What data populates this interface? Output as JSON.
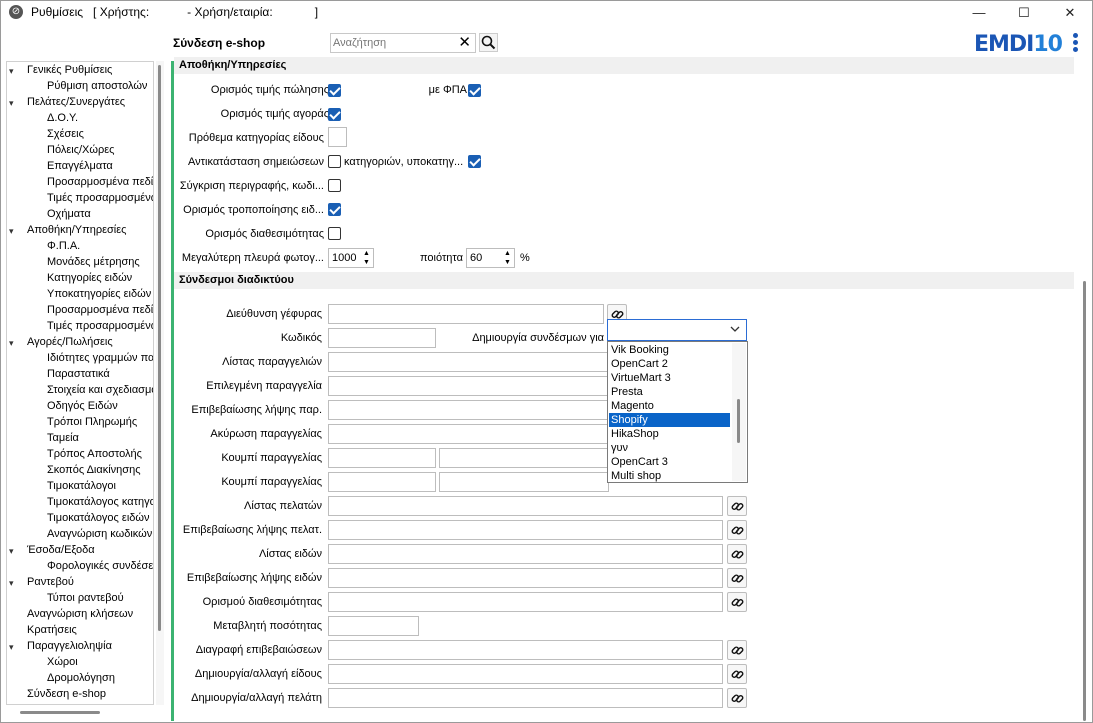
{
  "window": {
    "title_prefix": "Ρυθμίσεις",
    "user_label": "[ Χρήστης:",
    "company_label": "- Χρήση/εταιρία:",
    "close_bracket": "]",
    "minimize": "—",
    "maximize": "☐",
    "close": "✕"
  },
  "toolbar": {
    "screen_name": "Σύνδεση e-shop",
    "search_placeholder": "Αναζήτηση",
    "clear_glyph": "✕",
    "logo_a": "EMDI",
    "logo_b": "10"
  },
  "tree": [
    {
      "label": "Γενικές Ρυθμίσεις",
      "level": 0,
      "expanded": true
    },
    {
      "label": "Ρύθμιση αποστολών",
      "level": 2
    },
    {
      "label": "Πελάτες/Συνεργάτες",
      "level": 0,
      "expanded": true
    },
    {
      "label": "Δ.Ο.Υ.",
      "level": 2
    },
    {
      "label": "Σχέσεις",
      "level": 2
    },
    {
      "label": "Πόλεις/Χώρες",
      "level": 2
    },
    {
      "label": "Επαγγέλματα",
      "level": 2
    },
    {
      "label": "Προσαρμοσμένα πεδί",
      "level": 2
    },
    {
      "label": "Τιμές προσαρμοσμένω",
      "level": 2
    },
    {
      "label": "Οχήματα",
      "level": 2
    },
    {
      "label": "Αποθήκη/Υπηρεσίες",
      "level": 0,
      "expanded": true
    },
    {
      "label": "Φ.Π.Α.",
      "level": 2
    },
    {
      "label": "Μονάδες μέτρησης",
      "level": 2
    },
    {
      "label": "Κατηγορίες ειδών",
      "level": 2
    },
    {
      "label": "Υποκατηγορίες ειδών",
      "level": 2
    },
    {
      "label": "Προσαρμοσμένα πεδί",
      "level": 2
    },
    {
      "label": "Τιμές προσαρμοσμένω",
      "level": 2
    },
    {
      "label": "Αγορές/Πωλήσεις",
      "level": 0,
      "expanded": true
    },
    {
      "label": "Ιδιότητες γραμμών πα",
      "level": 2
    },
    {
      "label": "Παραστατικά",
      "level": 2
    },
    {
      "label": "Στοιχεία και σχεδιασμό",
      "level": 2
    },
    {
      "label": "Οδηγός Ειδών",
      "level": 2
    },
    {
      "label": "Τρόποι Πληρωμής",
      "level": 2
    },
    {
      "label": "Ταμεία",
      "level": 2
    },
    {
      "label": "Τρόπος Αποστολής",
      "level": 2
    },
    {
      "label": "Σκοπός Διακίνησης",
      "level": 2
    },
    {
      "label": "Τιμοκατάλογοι",
      "level": 2
    },
    {
      "label": "Τιμοκατάλογος κατηγο",
      "level": 2
    },
    {
      "label": "Τιμοκατάλογος ειδών",
      "level": 2
    },
    {
      "label": "Αναγνώριση κωδικών",
      "level": 2
    },
    {
      "label": "Έσοδα/Εξοδα",
      "level": 0,
      "expanded": true
    },
    {
      "label": "Φορολογικές συνδέσε",
      "level": 2
    },
    {
      "label": "Ραντεβού",
      "level": 0,
      "expanded": true
    },
    {
      "label": "Τύποι ραντεβού",
      "level": 2
    },
    {
      "label": "Αναγνώριση κλήσεων",
      "level": 1
    },
    {
      "label": "Κρατήσεις",
      "level": 1
    },
    {
      "label": "Παραγγελιοληψία",
      "level": 0,
      "expanded": true
    },
    {
      "label": "Χώροι",
      "level": 2
    },
    {
      "label": "Δρομολόγηση",
      "level": 2
    },
    {
      "label": "Σύνδεση e-shop",
      "level": 1
    }
  ],
  "sections": {
    "warehouse": "Αποθήκη/Υπηρεσίες",
    "links": "Σύνδεσμοι διαδικτύου"
  },
  "warehouse": {
    "sale_price": {
      "label": "Ορισμός τιμής πώλησης",
      "checked": true
    },
    "with_vat": {
      "label": "με ΦΠΑ",
      "checked": true
    },
    "purchase_price": {
      "label": "Ορισμός τιμής αγοράς",
      "checked": true
    },
    "category_prefix": {
      "label": "Πρόθεμα κατηγορίας είδους",
      "value": ""
    },
    "replace_notes": {
      "label": "Αντικατάσταση σημειώσεων",
      "checked": false
    },
    "categories_sub": {
      "label": "κατηγοριών, υποκατηγ...",
      "checked": true
    },
    "compare_desc": {
      "label": "Σύγκριση περιγραφής, κωδι...",
      "checked": false
    },
    "modify_item": {
      "label": "Ορισμός τροποποίησης ειδ...",
      "checked": true
    },
    "availability": {
      "label": "Ορισμός διαθεσιμότητας",
      "checked": false
    },
    "max_photo": {
      "label": "Μεγαλύτερη πλευρά φωτογ...",
      "value": "1000"
    },
    "quality": {
      "label": "ποιότητα",
      "value": "60",
      "unit": "%"
    }
  },
  "links": {
    "bridge_address": "Διεύθυνση γέφυρας",
    "code": "Κωδικός",
    "create_links_for": "Δημιουργία συνδέσμων για",
    "orders_list": "Λίστας παραγγελιών",
    "selected_order": "Επιλεγμένη παραγγελία",
    "order_receipt_confirm": "Επιβεβαίωσης λήψης παρ.",
    "order_cancel": "Ακύρωση παραγγελίας",
    "order_button_1": "Κουμπί παραγγελίας",
    "order_button_2": "Κουμπί παραγγελίας",
    "customers_list": "Λίστας πελατών",
    "customer_receipt_confirm": "Επιβεβαίωσης λήψης πελατ.",
    "items_list": "Λίστας ειδών",
    "items_receipt_confirm": "Επιβεβαίωσης λήψης ειδών",
    "availability_def": "Ορισμού διαθεσιμότητας",
    "quantity_variable": "Μεταβλητή ποσότητας",
    "delete_confirmations": "Διαγραφή επιβεβαιώσεων",
    "create_change_item": "Δημιουργία/αλλαγή είδους",
    "create_change_customer": "Δημιουργία/αλλαγή πελάτη"
  },
  "platform_dropdown": {
    "selected": "",
    "options": [
      "Vik Booking",
      "OpenCart 2",
      "VirtueMart 3",
      "Presta",
      "Magento",
      "Shopify",
      "HikaShop",
      "γυν",
      "OpenCart 3",
      "Multi shop"
    ],
    "highlighted": "Shopify"
  },
  "colors": {
    "accent": "#1a5fb4",
    "highlight": "#0a64c8",
    "green_bar": "#3cb371",
    "section_bg": "#f0f0f0"
  }
}
